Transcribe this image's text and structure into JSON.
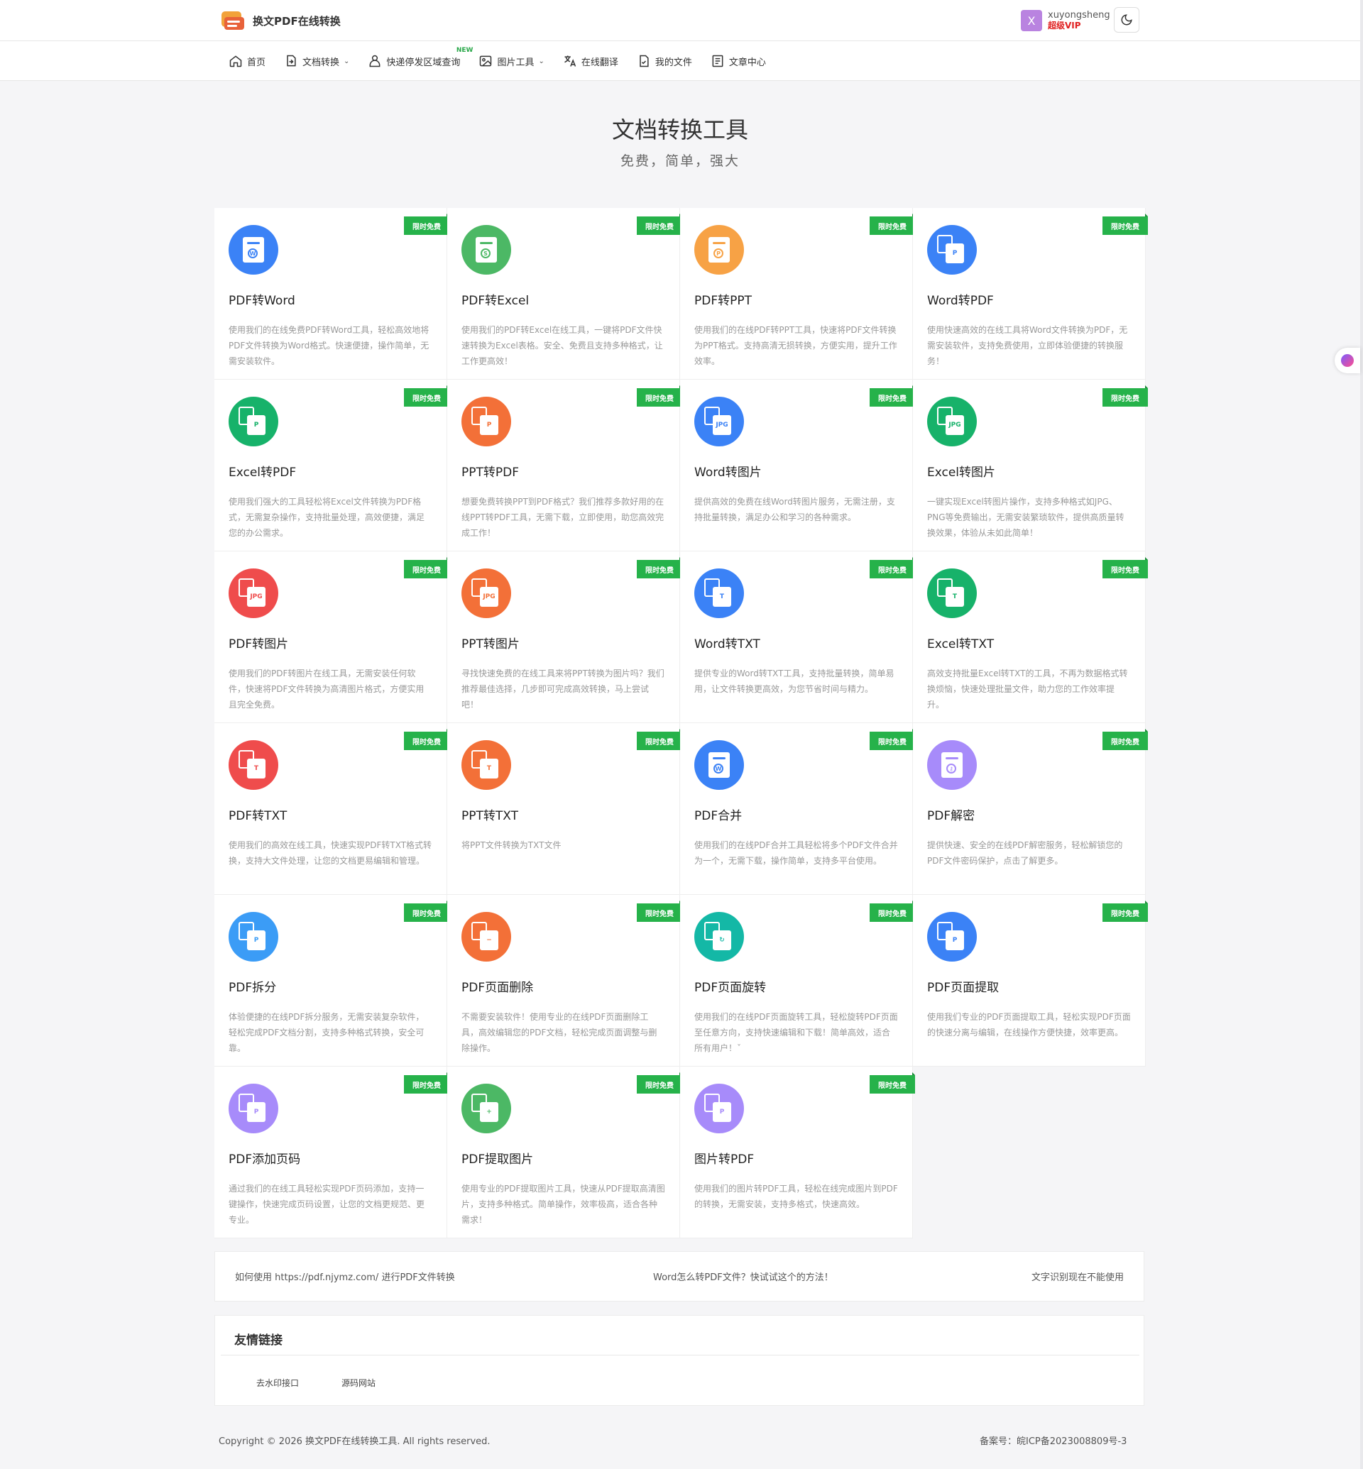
{
  "header": {
    "logo_text": "换文PDF在线转换",
    "user": {
      "avatar_letter": "X",
      "name": "xuyongsheng",
      "vip": "超级VIP"
    }
  },
  "nav": {
    "items": [
      {
        "label": "首页",
        "icon": "home-icon",
        "dropdown": false
      },
      {
        "label": "文档转换",
        "icon": "doc-convert-icon",
        "dropdown": true
      },
      {
        "label": "快递停发区域查询",
        "icon": "user-icon",
        "dropdown": false,
        "badge": "NEW"
      },
      {
        "label": "图片工具",
        "icon": "image-icon",
        "dropdown": true
      },
      {
        "label": "在线翻译",
        "icon": "translate-icon",
        "dropdown": false
      },
      {
        "label": "我的文件",
        "icon": "file-check-icon",
        "dropdown": false
      },
      {
        "label": "文章中心",
        "icon": "article-icon",
        "dropdown": false
      }
    ]
  },
  "hero": {
    "title": "文档转换工具",
    "subtitle": "免费，简单，强大"
  },
  "ribbon_label": "限时免费",
  "tools": [
    {
      "title": "PDF转Word",
      "desc": "使用我们的在线免费PDF转Word工具，轻松高效地将PDF文件转换为Word格式。快速便捷，操作简单，无需安装软件。",
      "color": "#3b82f6",
      "glyph": "W"
    },
    {
      "title": "PDF转Excel",
      "desc": "使用我们的PDF转Excel在线工具，一键将PDF文件快速转换为Excel表格。安全、免费且支持多种格式，让工作更高效！",
      "color": "#4cb865",
      "glyph": "S"
    },
    {
      "title": "PDF转PPT",
      "desc": "使用我们的在线PDF转PPT工具，快速将PDF文件转换为PPT格式。支持高清无损转换，方便实用，提升工作效率。",
      "color": "#f7a245",
      "glyph": "P"
    },
    {
      "title": "Word转PDF",
      "desc": "使用快速高效的在线工具将Word文件转换为PDF，无需安装软件，支持免费使用，立即体验便捷的转换服务！",
      "color": "#3b82f6",
      "glyph": "P"
    },
    {
      "title": "Excel转PDF",
      "desc": "使用我们强大的工具轻松将Excel文件转换为PDF格式，无需复杂操作，支持批量处理，高效便捷，满足您的办公需求。",
      "color": "#17b26a",
      "glyph": "P"
    },
    {
      "title": "PPT转PDF",
      "desc": "想要免费转换PPT到PDF格式？我们推荐多款好用的在线PPT转PDF工具，无需下载，立即使用，助您高效完成工作！",
      "color": "#f37038",
      "glyph": "P"
    },
    {
      "title": "Word转图片",
      "desc": "提供高效的免费在线Word转图片服务，无需注册，支持批量转换，满足办公和学习的各种需求。",
      "color": "#3b82f6",
      "glyph": "JPG"
    },
    {
      "title": "Excel转图片",
      "desc": "一键实现Excel转图片操作，支持多种格式如JPG、PNG等免费输出，无需安装繁琐软件，提供高质量转换效果，体验从未如此简单！",
      "color": "#17b26a",
      "glyph": "JPG"
    },
    {
      "title": "PDF转图片",
      "desc": "使用我们的PDF转图片在线工具，无需安装任何软件，快速将PDF文件转换为高清图片格式，方便实用且完全免费。",
      "color": "#ef4c4c",
      "glyph": "JPG"
    },
    {
      "title": "PPT转图片",
      "desc": "寻找快速免费的在线工具来将PPT转换为图片吗？我们推荐最佳选择，几步即可完成高效转换，马上尝试吧！",
      "color": "#f37038",
      "glyph": "JPG"
    },
    {
      "title": "Word转TXT",
      "desc": "提供专业的Word转TXT工具，支持批量转换，简单易用，让文件转换更高效，为您节省时间与精力。",
      "color": "#3b82f6",
      "glyph": "T"
    },
    {
      "title": "Excel转TXT",
      "desc": "高效支持批量Excel转TXT的工具，不再为数据格式转换烦恼，快速处理批量文件，助力您的工作效率提升。",
      "color": "#17b26a",
      "glyph": "T"
    },
    {
      "title": "PDF转TXT",
      "desc": "使用我们的高效在线工具，快速实现PDF转TXT格式转换，支持大文件处理，让您的文档更易编辑和管理。",
      "color": "#ef4c4c",
      "glyph": "T"
    },
    {
      "title": "PPT转TXT",
      "desc": "将PPT文件转换为TXT文件",
      "color": "#f37038",
      "glyph": "T"
    },
    {
      "title": "PDF合并",
      "desc": "使用我们的在线PDF合并工具轻松将多个PDF文件合并为一个，无需下载，操作简单，支持多平台使用。",
      "color": "#3b82f6",
      "glyph": "W"
    },
    {
      "title": "PDF解密",
      "desc": "提供快速、安全的在线PDF解密服务，轻松解锁您的PDF文件密码保护，点击了解更多。",
      "color": "#a78bfa",
      "glyph": "⚷"
    },
    {
      "title": "PDF拆分",
      "desc": "体验便捷的在线PDF拆分服务，无需安装复杂软件，轻松完成PDF文档分割，支持多种格式转换，安全可靠。",
      "color": "#3b9cf6",
      "glyph": "P"
    },
    {
      "title": "PDF页面删除",
      "desc": "不需要安装软件！使用专业的在线PDF页面删除工具，高效编辑您的PDF文档，轻松完成页面调整与删除操作。",
      "color": "#f37038",
      "glyph": "−"
    },
    {
      "title": "PDF页面旋转",
      "desc": "使用我们的在线PDF页面旋转工具，轻松旋转PDF页面至任意方向，支持快速编辑和下载！简单高效，适合所有用户！ˇ",
      "color": "#14b8a6",
      "glyph": "↻"
    },
    {
      "title": "PDF页面提取",
      "desc": "使用我们专业的PDF页面提取工具，轻松实现PDF页面的快速分离与编辑，在线操作方便快捷，效率更高。",
      "color": "#3b82f6",
      "glyph": "P"
    },
    {
      "title": "PDF添加页码",
      "desc": "通过我们的在线工具轻松实现PDF页码添加，支持一键操作，快速完成页码设置，让您的文档更规范、更专业。",
      "color": "#a78bfa",
      "glyph": "P"
    },
    {
      "title": "PDF提取图片",
      "desc": "使用专业的PDF提取图片工具，快速从PDF提取高清图片，支持多种格式。简单操作，效率极高，适合各种需求！",
      "color": "#4cb865",
      "glyph": "+"
    },
    {
      "title": "图片转PDF",
      "desc": "使用我们的图片转PDF工具，轻松在线完成图片到PDF的转换，无需安装，支持多格式，快速高效。",
      "color": "#a78bfa",
      "glyph": "P"
    }
  ],
  "links_bar": [
    "如何使用 https://pdf.njymz.com/ 进行PDF文件转换",
    "Word怎么转PDF文件？快试试这个的方法！",
    "文字识别现在不能使用"
  ],
  "friends": {
    "title": "友情链接",
    "items": [
      "去水印接口",
      "源码网站"
    ]
  },
  "footer": {
    "copyright": "Copyright © 2026 换文PDF在线转换工具. All rights reserved.",
    "icp": "备案号：皖ICP备2023008809号-3"
  }
}
